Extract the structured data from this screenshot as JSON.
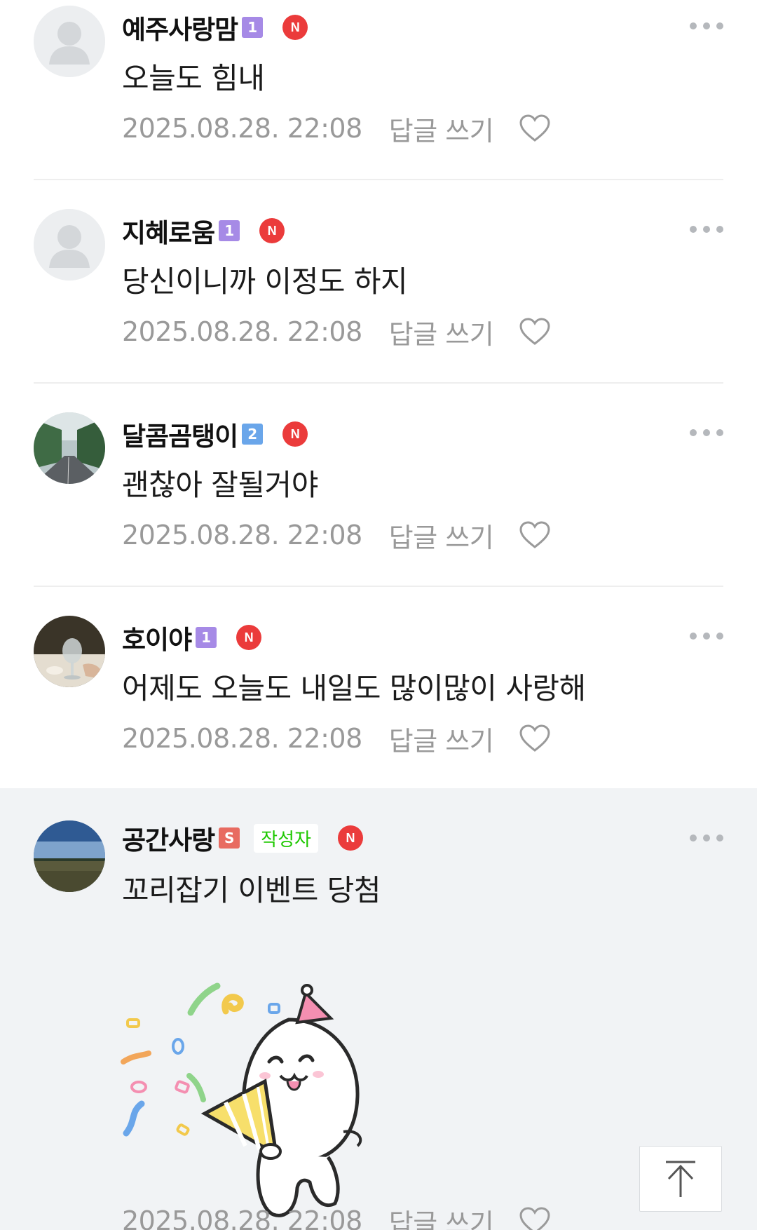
{
  "comments": [
    {
      "nickname": "예주사랑맘",
      "grade": "1",
      "new_badge": "N",
      "text": "오늘도 힘내",
      "date": "2025.08.28. 22:08",
      "reply_label": "답글 쓰기",
      "avatar": "default-profile"
    },
    {
      "nickname": "지혜로움",
      "grade": "1",
      "new_badge": "N",
      "text": "당신이니까 이정도 하지",
      "date": "2025.08.28. 22:08",
      "reply_label": "답글 쓰기",
      "avatar": "default-profile"
    },
    {
      "nickname": "달콤곰탱이",
      "grade": "2",
      "new_badge": "N",
      "text": "괜찮아 잘될거야",
      "date": "2025.08.28. 22:08",
      "reply_label": "답글 쓰기",
      "avatar": "tree-lined-road-photo"
    },
    {
      "nickname": "호이야",
      "grade": "1",
      "new_badge": "N",
      "text": "어제도 오늘도 내일도 많이많이 사랑해",
      "date": "2025.08.28. 22:08",
      "reply_label": "답글 쓰기",
      "avatar": "wine-glass-photo"
    },
    {
      "nickname": "공간사랑",
      "grade": "S",
      "author_tag": "작성자",
      "new_badge": "N",
      "text": "꼬리잡기 이벤트 당첨",
      "sticker": "party-cat-sticker",
      "date": "2025.08.28. 22:08",
      "reply_label": "답글 쓰기",
      "avatar": "field-sky-photo"
    }
  ],
  "colors": {
    "grade_purple": "#a68ae6",
    "grade_blue": "#6aa6ea",
    "grade_staff": "#e86b61",
    "new_badge": "#eb3b3b",
    "author_tag": "#1ec800",
    "highlight_bg": "#f1f3f5"
  },
  "icons": {
    "more": "more-horizontal-icon",
    "like": "heart-outline-icon",
    "top": "arrow-up-icon"
  }
}
